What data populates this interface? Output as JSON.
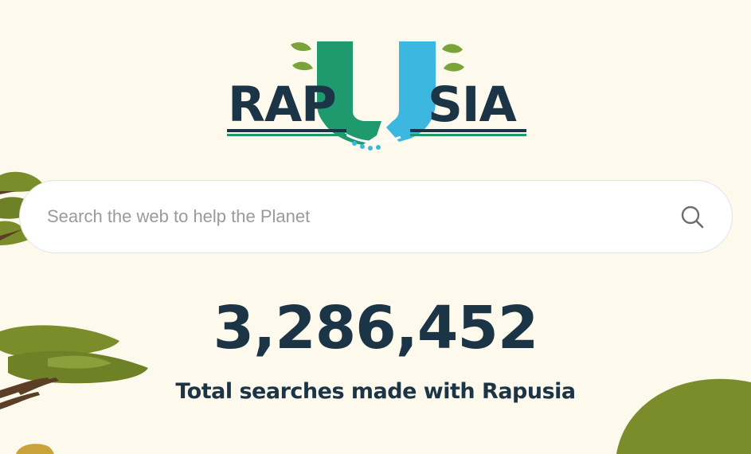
{
  "logo": {
    "text_left": "RAP",
    "text_right": "SIA",
    "colors": {
      "text": "#1b3446",
      "left_hand": "#1f9a6e",
      "right_hand": "#3cb8e0",
      "leaf": "#7aa33a"
    }
  },
  "search": {
    "placeholder": "Search the web to help the Planet",
    "value": "",
    "icon": "search-icon"
  },
  "stats": {
    "total_searches": "3,286,452",
    "label": "Total searches made with Rapusia"
  },
  "colors": {
    "background": "#fdf9ec",
    "text": "#1b3446",
    "foliage": "#7b8d2b",
    "trunk": "#5a3e26"
  }
}
